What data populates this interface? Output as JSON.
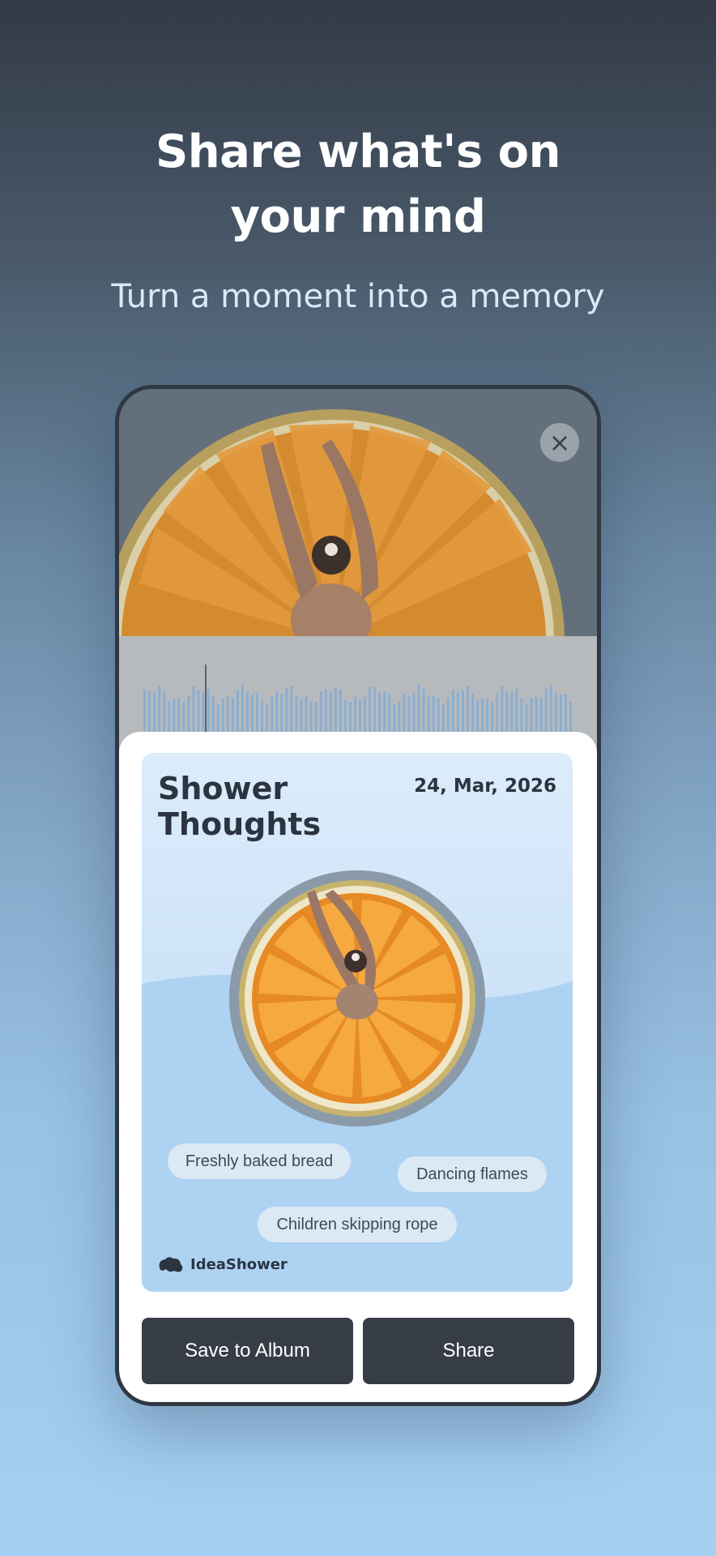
{
  "headline": {
    "line1": "Share what's on",
    "line2": "your mind"
  },
  "subheadline": "Turn a moment into a memory",
  "close_icon": "close-icon",
  "card": {
    "title_line1": "Shower",
    "title_line2": "Thoughts",
    "date": "24, Mar, 2026",
    "tags": [
      "Freshly baked bread",
      "Dancing flames",
      "Children skipping rope"
    ],
    "brand_name": "IdeaShower"
  },
  "buttons": {
    "save_label": "Save to Album",
    "share_label": "Share"
  },
  "colors": {
    "button_bg": "#363d47",
    "card_bg": "#cfe4f8",
    "tag_bg": "#dbe9f5",
    "text_dark": "#2b3440"
  }
}
